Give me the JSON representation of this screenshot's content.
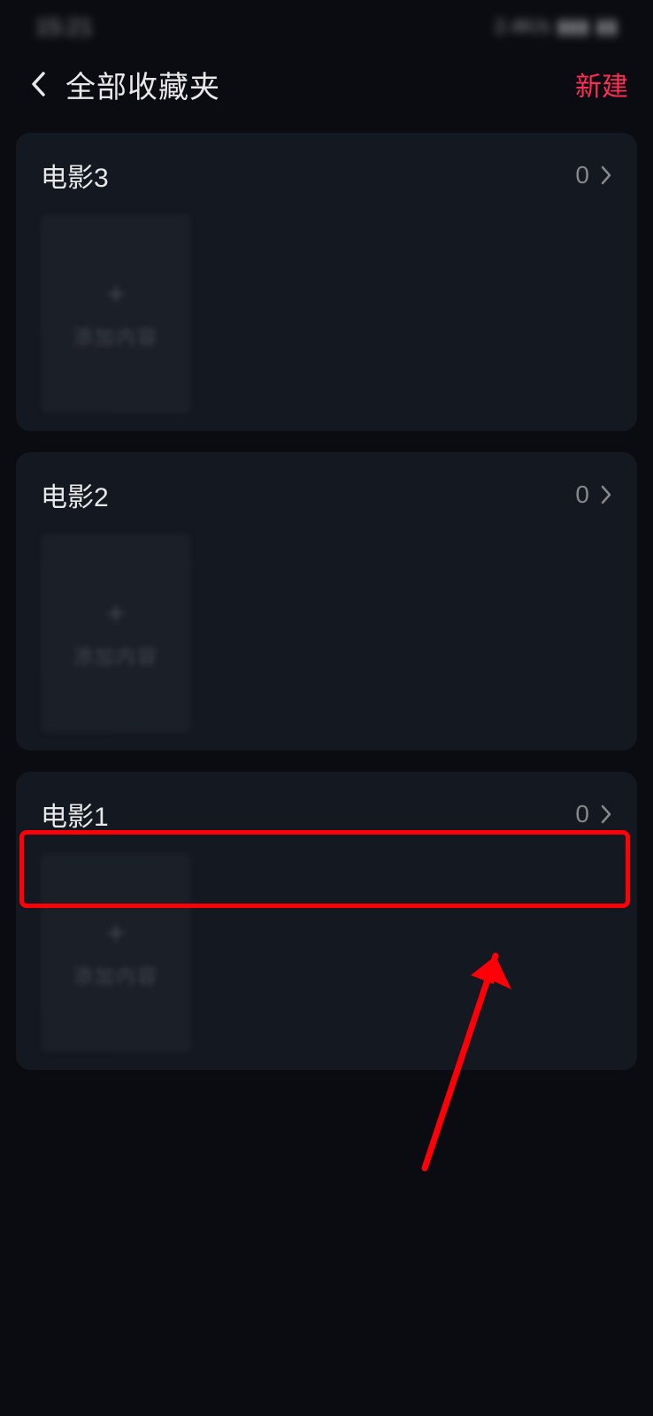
{
  "status_bar": {
    "time": "15:21",
    "net_speed": "2.4K/s"
  },
  "header": {
    "title": "全部收藏夹",
    "new_label": "新建"
  },
  "folders": [
    {
      "name": "电影3",
      "count": "0"
    },
    {
      "name": "电影2",
      "count": "0"
    },
    {
      "name": "电影1",
      "count": "0"
    }
  ],
  "thumb_placeholder": "添加内容",
  "annotation": {
    "highlight_index": 2
  }
}
